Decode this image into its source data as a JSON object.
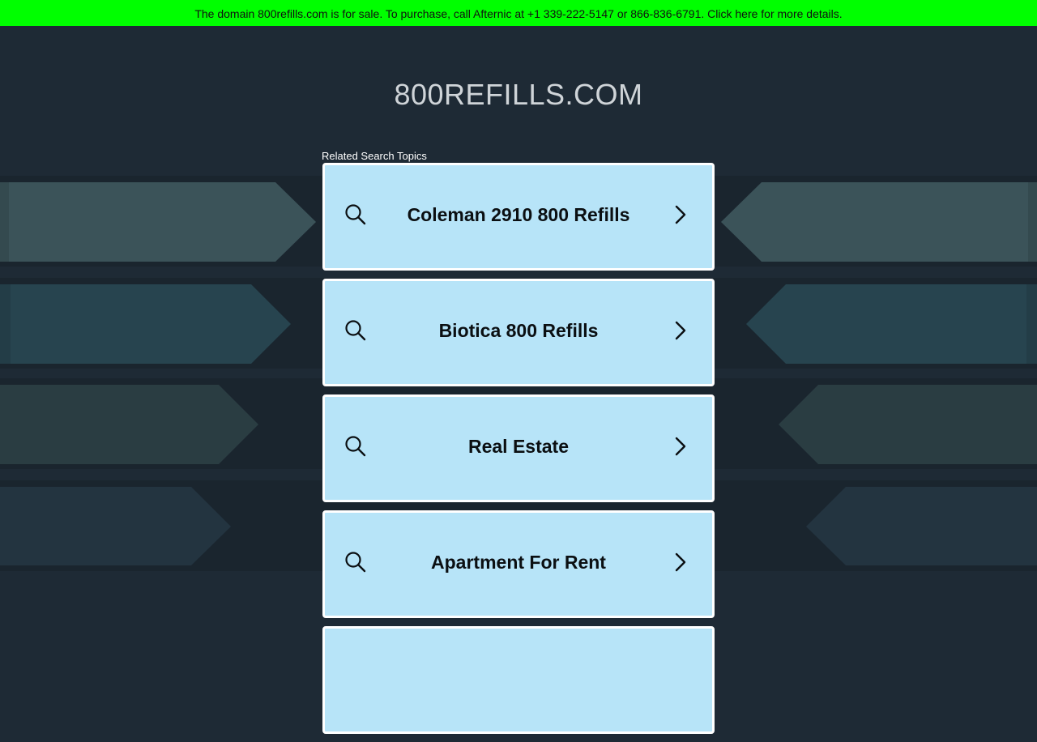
{
  "banner": {
    "text": "The domain 800refills.com is for sale. To purchase, call Afternic at +1 339-222-5147 or 866-836-6791. Click here for more details."
  },
  "site": {
    "title": "800REFILLS.COM"
  },
  "related": {
    "label": "Related Search Topics",
    "items": [
      {
        "label": "Coleman 2910 800 Refills"
      },
      {
        "label": "Biotica 800 Refills"
      },
      {
        "label": "Real Estate"
      },
      {
        "label": "Apartment For Rent"
      },
      {
        "label": ""
      }
    ]
  },
  "colors": {
    "banner_bg": "#00ff00",
    "page_bg": "#1e2a35",
    "card_bg": "#b7e4f8",
    "card_border": "#ffffff"
  },
  "icons": {
    "card_left": "search-icon",
    "card_right": "chevron-right-icon"
  }
}
